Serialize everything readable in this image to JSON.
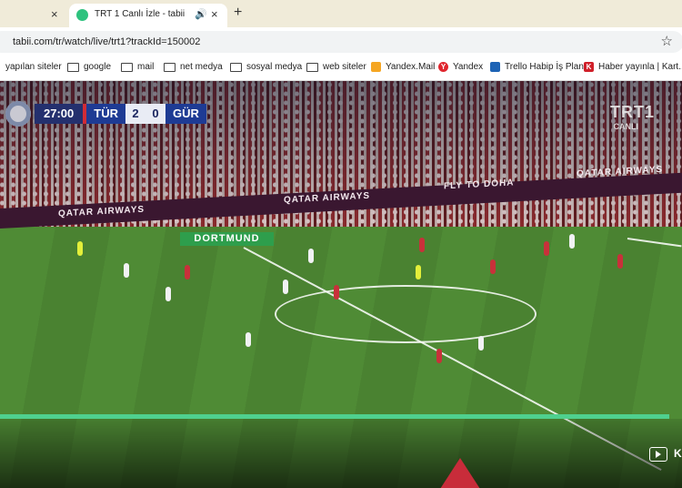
{
  "tabs": [
    {
      "title": "",
      "close": "×"
    },
    {
      "title": "TRT 1 Canlı İzle - tabii",
      "audio": "🔊",
      "close": "×"
    }
  ],
  "newtab": "+",
  "address": {
    "url": "tabii.com/tr/watch/live/trt1?trackId=150002",
    "star": "☆"
  },
  "bookmarks": [
    {
      "label": "yapılan siteler"
    },
    {
      "label": "google"
    },
    {
      "label": "mail"
    },
    {
      "label": "net medya"
    },
    {
      "label": "sosyal medya"
    },
    {
      "label": "web siteler"
    },
    {
      "label": "Yandex.Mail"
    },
    {
      "label": "Yandex"
    },
    {
      "label": "Trello Habip İş Planı"
    },
    {
      "label": "Haber yayınla | Kart..."
    }
  ],
  "scoreboard": {
    "time": "27:00",
    "home": "TÜR",
    "home_score": "2",
    "away_score": "0",
    "away": "GÜR"
  },
  "channel": {
    "name": "TRT1",
    "sub": "CANLI"
  },
  "ads": {
    "left": "QATAR AIRWAYS",
    "middle": "QATAR AIRWAYS",
    "fly": "FLY TO DOHA",
    "right": "QATAR AIRWAYS",
    "venue": "DORTMUND"
  },
  "player_label": "K",
  "colors": {
    "accent": "#4fd08e",
    "tab_bg": "#f0ebd9",
    "score_blue": "#1e3b94"
  }
}
